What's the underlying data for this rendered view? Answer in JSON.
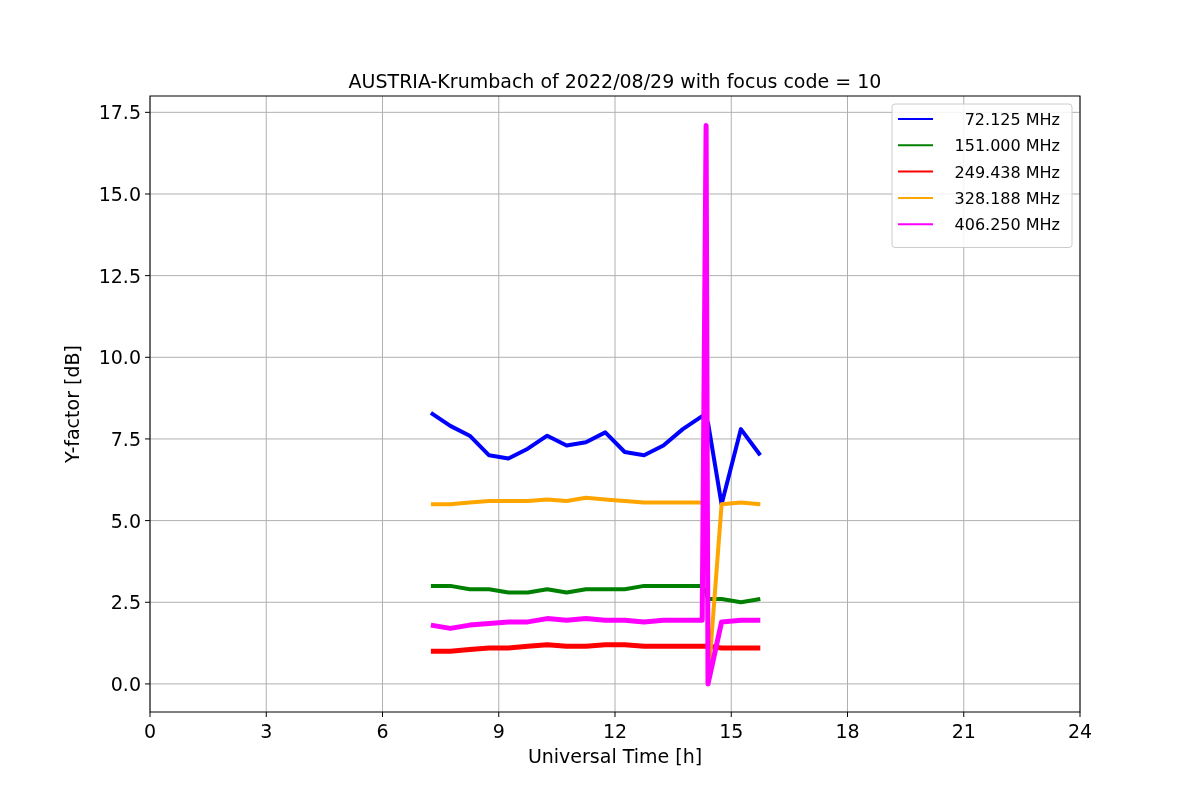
{
  "chart_data": {
    "type": "line",
    "title": "AUSTRIA-Krumbach of 2022/08/29 with focus code = 10",
    "xlabel": "Universal Time [h]",
    "ylabel": "Y-factor [dB]",
    "x": [
      7.25,
      7.75,
      8.25,
      8.75,
      9.25,
      9.75,
      10.25,
      10.75,
      11.25,
      11.75,
      12.25,
      12.75,
      13.25,
      13.75,
      14.25,
      14.35,
      14.4,
      14.75,
      15.25,
      15.75
    ],
    "series": [
      {
        "name": "72.125 MHz",
        "color": "#0000ff",
        "values": [
          8.3,
          7.9,
          7.6,
          7.0,
          6.9,
          7.2,
          7.6,
          7.3,
          7.4,
          7.7,
          7.1,
          7.0,
          7.3,
          7.8,
          8.2,
          8.0,
          8.0,
          5.5,
          7.8,
          7.0
        ]
      },
      {
        "name": "151.000 MHz",
        "color": "#008000",
        "values": [
          3.0,
          3.0,
          2.9,
          2.9,
          2.8,
          2.8,
          2.9,
          2.8,
          2.9,
          2.9,
          2.9,
          3.0,
          3.0,
          3.0,
          3.0,
          2.8,
          2.6,
          2.6,
          2.5,
          2.6
        ]
      },
      {
        "name": "249.438 MHz",
        "color": "#ff0000",
        "values": [
          1.0,
          1.0,
          1.05,
          1.1,
          1.1,
          1.15,
          1.2,
          1.15,
          1.15,
          1.2,
          1.2,
          1.15,
          1.15,
          1.15,
          1.15,
          1.15,
          1.15,
          1.1,
          1.1,
          1.1
        ]
      },
      {
        "name": "328.188 MHz",
        "color": "#ffa500",
        "values": [
          5.5,
          5.5,
          5.55,
          5.6,
          5.6,
          5.6,
          5.65,
          5.6,
          5.7,
          5.65,
          5.6,
          5.55,
          5.55,
          5.55,
          5.55,
          null,
          0.0,
          5.5,
          5.55,
          5.5
        ]
      },
      {
        "name": "406.250 MHz",
        "color": "#ff00ff",
        "values": [
          1.8,
          1.7,
          1.8,
          1.85,
          1.9,
          1.9,
          2.0,
          1.95,
          2.0,
          1.95,
          1.95,
          1.9,
          1.95,
          1.95,
          1.95,
          17.1,
          0.0,
          1.9,
          1.95,
          1.95
        ]
      }
    ],
    "grid": true,
    "legend": true,
    "xlim": [
      0,
      24
    ],
    "ylim": [
      -0.86,
      18.0
    ],
    "xticks": [
      0,
      3,
      6,
      9,
      12,
      15,
      18,
      21,
      24
    ],
    "yticks": [
      {
        "value": 0,
        "label": "0.0"
      },
      {
        "value": 2.5,
        "label": "2.5"
      },
      {
        "value": 5,
        "label": "5.0"
      },
      {
        "value": 7.5,
        "label": "7.5"
      },
      {
        "value": 10,
        "label": "10.0"
      },
      {
        "value": 12.5,
        "label": "12.5"
      },
      {
        "value": 15,
        "label": "15.0"
      },
      {
        "value": 17.5,
        "label": "17.5"
      }
    ]
  }
}
